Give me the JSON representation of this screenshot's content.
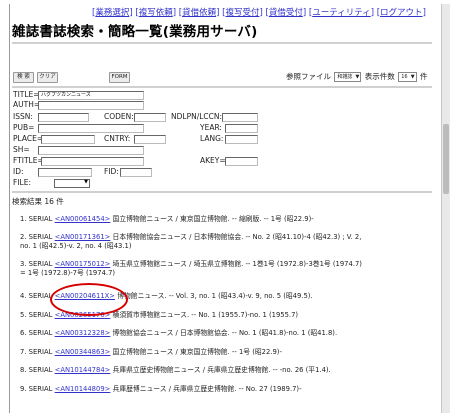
{
  "nav": {
    "open": "[",
    "items": [
      "業務選択",
      "複写依頼",
      "貸借依頼",
      "複写受付",
      "貸借受付",
      "ユーティリティ",
      "ログアウト"
    ],
    "close": "]"
  },
  "page_title": "雑誌書誌検索・簡略一覧(業務用サーバ)",
  "buttons": {
    "search": "検 索",
    "clear": "クリア",
    "form": "FORM"
  },
  "ref_file": {
    "label": "参照ファイル",
    "file_value": "和雑誌",
    "count_label": "表示件数",
    "count_value": "16",
    "count_suffix": "件"
  },
  "form": {
    "title_label": "TITLE=",
    "title_value": "ハクブツカンニュース",
    "auth_label": "AUTH=",
    "issn_label": "ISSN:",
    "coden_label": "CODEN:",
    "ndlpn_label": "NDLPN/LCCN:",
    "pub_label": "PUB=",
    "year_label": "YEAR:",
    "place_label": "PLACE=",
    "cntry_label": "CNTRY:",
    "lang_label": "LANG:",
    "sh_label": "SH=",
    "ftitle_label": "FTITLE=",
    "akey_label": "AKEY=",
    "id_label": "ID:",
    "fid_label": "FID:",
    "file_label": "FILE:"
  },
  "result_count": "検索結果 16 件",
  "results": [
    {
      "num": "1.",
      "prefix": "SERIAL",
      "id": "<AN00061454>",
      "lines": [
        "国立博物館ニュース / 東京国立博物館. -- 縮刷版. -- 1号 (昭22.9)-"
      ]
    },
    {
      "num": "2.",
      "prefix": "SERIAL",
      "id": "<AN00171361>",
      "lines": [
        "日本博物館協会ニュース / 日本博物館協会. -- No. 2 (昭41.10)-4 (昭42.3) ; V. 2,",
        "no. 1 (昭42.5)-v. 2, no. 4 (昭43.1)"
      ]
    },
    {
      "num": "3.",
      "prefix": "SERIAL",
      "id": "<AN00175012>",
      "lines": [
        "埼玉県立博物館ニュース / 埼玉県立博物館. -- 1巻1号 (1972.8)-3巻1号 (1974.7)",
        "= 1号 (1972.8)-7号 (1974.7)"
      ]
    },
    {
      "num": "4.",
      "prefix": "SERIAL",
      "id": "<AN00204611X>",
      "lines": [
        "博物館ニュース. -- Vol. 3, no. 1 (昭43.4)-v. 9, no. 5 (昭49.5)."
      ]
    },
    {
      "num": "5.",
      "prefix": "SERIAL",
      "id": "<AN00265170>",
      "lines": [
        "横須賀市博物館ニュース. -- No. 1 (1955.7)-no. 1 (1955.7)"
      ]
    },
    {
      "num": "6.",
      "prefix": "SERIAL",
      "id": "<AN00312328>",
      "lines": [
        "博物館協会ニュース / 日本博物館協会. -- No. 1 (昭41.8)-no. 1 (昭41.8)."
      ]
    },
    {
      "num": "7.",
      "prefix": "SERIAL",
      "id": "<AN00344863>",
      "lines": [
        "国立博物館ニュース / 東京国立博物館. -- 1号 (昭22.9)-"
      ]
    },
    {
      "num": "8.",
      "prefix": "SERIAL",
      "id": "<AN10144784>",
      "lines": [
        "兵庫県立歴史博物館ニュース / 兵庫県立歴史博物館. -- -no. 26 (平1.4)."
      ]
    },
    {
      "num": "9.",
      "prefix": "SERIAL",
      "id": "<AN10144809>",
      "lines": [
        "兵庫歴博ニュース / 兵庫県立歴史博物館. -- No. 27 (1989.7)-"
      ]
    }
  ]
}
